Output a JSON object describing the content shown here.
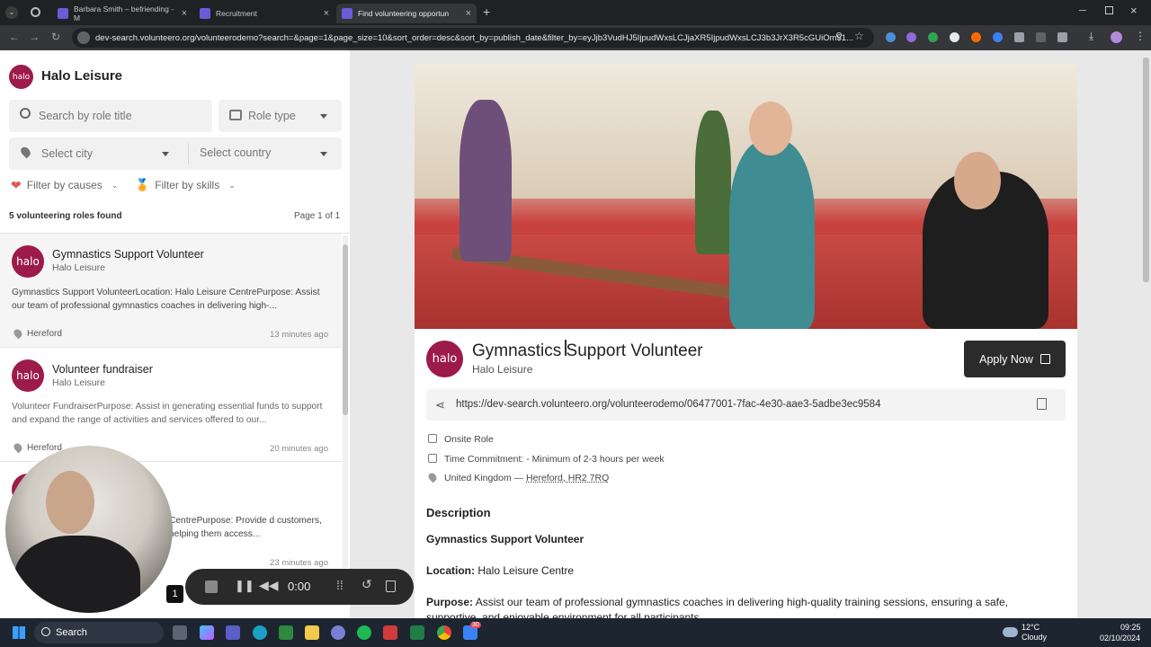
{
  "browser": {
    "tabs": [
      {
        "title": "Barbara Smith – befriending - M"
      },
      {
        "title": "Recruitment"
      },
      {
        "title": "Find volunteering opportun"
      }
    ],
    "url": "dev-search.volunteero.org/volunteerodemo?search=&page=1&page_size=10&sort_order=desc&sort_by=publish_date&filter_by=eyJjb3VudHJ5IjpudWxsLCJjaXR5IjpudWxsLCJ3b3JrX3R5cGUiOm51..."
  },
  "org": {
    "name": "Halo Leisure",
    "logo_text": "halo"
  },
  "filters": {
    "search_placeholder": "Search by role title",
    "role_type_placeholder": "Role type",
    "city_placeholder": "Select city",
    "country_placeholder": "Select country",
    "causes_label": "Filter by causes",
    "skills_label": "Filter by skills"
  },
  "results": {
    "count_text": "5 volunteering roles found",
    "page_text": "Page 1 of 1",
    "items": [
      {
        "title": "Gymnastics Support Volunteer",
        "org": "Halo Leisure",
        "desc": "Gymnastics Support VolunteerLocation: Halo Leisure CentrePurpose: Assist our team of professional gymnastics coaches in delivering high-...",
        "location": "Hereford",
        "ago": "13 minutes ago"
      },
      {
        "title": "Volunteer fundraiser",
        "org": "Halo Leisure",
        "desc": "Volunteer FundraiserPurpose: Assist in generating essential funds to support and expand the range of activities and services offered to our...",
        "location": "Hereford",
        "ago": "20 minutes ago"
      },
      {
        "desc": "CentrePurpose: Provide d customers, helping them access...",
        "ago": "23 minutes ago"
      }
    ]
  },
  "detail": {
    "title": "Gymnastics Support Volunteer",
    "org": "Halo Leisure",
    "apply_label": "Apply Now",
    "share_url": "https://dev-search.volunteero.org/volunteerodemo/06477001-7fac-4e30-aae3-5adbe3ec9584",
    "role_type": "Onsite Role",
    "time_commitment": "Time Commitment: - Minimum of 2-3 hours per week",
    "location_prefix": "United Kingdom — ",
    "location_link": "Hereford, HR2 7RQ",
    "description_heading": "Description",
    "desc_title": "Gymnastics Support Volunteer",
    "location_label": "Location:",
    "location_value": " Halo Leisure Centre",
    "purpose_label": "Purpose:",
    "purpose_value": " Assist our team of professional gymnastics coaches in delivering high-quality training sessions, ensuring a safe, supportive, and enjoyable environment for all participants."
  },
  "recorder": {
    "time": "0:00",
    "badge": "1"
  },
  "taskbar": {
    "search_label": "Search",
    "temp": "12°C",
    "weather": "Cloudy",
    "time": "09:25",
    "date": "02/10/2024",
    "notif": "30"
  },
  "colors": {
    "brand": "#9c1b4a",
    "apply_bg": "#2b2b2b"
  }
}
